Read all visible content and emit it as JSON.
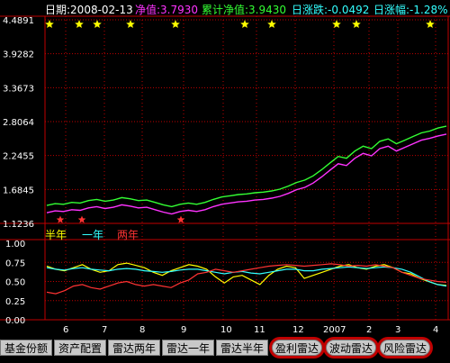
{
  "header": {
    "date_label": "日期:",
    "date_value": "2008-02-13",
    "nav_label": "净值:",
    "nav_value": "3.7930",
    "cum_label": "累计净值:",
    "cum_value": "3.9430",
    "chg_label": "日涨跌:",
    "chg_value": "-0.0492",
    "pct_label": "日涨幅:",
    "pct_value": "-1.28%"
  },
  "colors": {
    "nav_series": "#ff33ff",
    "cum_series": "#33ff33",
    "half_year": "#ffff00",
    "one_year": "#33ffff",
    "two_year": "#ff3333",
    "axis": "#c00000",
    "tick_text": "#ffffff"
  },
  "legend": {
    "half_year": "半年",
    "one_year": "一年",
    "two_year": "两年"
  },
  "tabs": [
    {
      "label": "基金份额",
      "ring": false
    },
    {
      "label": "资产配置",
      "ring": false
    },
    {
      "label": "雷达两年",
      "ring": false
    },
    {
      "label": "雷达一年",
      "ring": false
    },
    {
      "label": "雷达半年",
      "ring": false
    },
    {
      "label": "盈利雷达",
      "ring": true
    },
    {
      "label": "波动雷达",
      "ring": true
    },
    {
      "label": "风险雷达",
      "ring": true
    }
  ],
  "chart_data": [
    {
      "type": "line",
      "ylim": [
        1.1236,
        4.4891
      ],
      "y_ticks": [
        "4.4891",
        "3.9282",
        "3.3673",
        "2.8064",
        "2.2455",
        "1.6845",
        "1.1236"
      ],
      "x_ticks": [
        "6",
        "7",
        "8",
        "9",
        "10",
        "11",
        "12",
        "2007",
        "2",
        "3",
        "4"
      ],
      "series": [
        {
          "key": "cum",
          "values": [
            1.42,
            1.45,
            1.44,
            1.47,
            1.46,
            1.5,
            1.52,
            1.49,
            1.51,
            1.55,
            1.53,
            1.5,
            1.51,
            1.47,
            1.43,
            1.4,
            1.44,
            1.46,
            1.44,
            1.47,
            1.52,
            1.56,
            1.58,
            1.6,
            1.61,
            1.63,
            1.64,
            1.66,
            1.69,
            1.74,
            1.8,
            1.84,
            1.91,
            2.01,
            2.12,
            2.23,
            2.2,
            2.32,
            2.4,
            2.36,
            2.48,
            2.52,
            2.44,
            2.5,
            2.56,
            2.62,
            2.65,
            2.7,
            2.73
          ]
        },
        {
          "key": "nav",
          "values": [
            1.3,
            1.33,
            1.32,
            1.35,
            1.34,
            1.38,
            1.4,
            1.37,
            1.39,
            1.43,
            1.41,
            1.38,
            1.39,
            1.35,
            1.31,
            1.28,
            1.32,
            1.34,
            1.32,
            1.35,
            1.4,
            1.44,
            1.46,
            1.48,
            1.49,
            1.51,
            1.52,
            1.54,
            1.57,
            1.62,
            1.68,
            1.72,
            1.79,
            1.89,
            2.0,
            2.11,
            2.08,
            2.2,
            2.28,
            2.24,
            2.36,
            2.4,
            2.32,
            2.38,
            2.44,
            2.5,
            2.53,
            2.57,
            2.6
          ]
        }
      ],
      "star_markers_top_count": 9,
      "star_markers_bottom_count": 3
    },
    {
      "type": "line",
      "ylim": [
        0.0,
        1.0
      ],
      "y_ticks": [
        "1.00",
        "0.75",
        "0.50",
        "0.25",
        "0.00"
      ],
      "series": [
        {
          "key": "half_year",
          "name": "半年",
          "values": [
            0.7,
            0.66,
            0.64,
            0.68,
            0.72,
            0.66,
            0.62,
            0.64,
            0.72,
            0.74,
            0.71,
            0.68,
            0.62,
            0.58,
            0.64,
            0.68,
            0.72,
            0.7,
            0.66,
            0.56,
            0.48,
            0.56,
            0.58,
            0.52,
            0.46,
            0.58,
            0.66,
            0.7,
            0.68,
            0.54,
            0.58,
            0.62,
            0.66,
            0.7,
            0.72,
            0.68,
            0.66,
            0.7,
            0.72,
            0.68,
            0.62,
            0.6,
            0.54,
            0.5,
            0.46,
            0.45
          ]
        },
        {
          "key": "one_year",
          "name": "一年",
          "values": [
            0.68,
            0.66,
            0.65,
            0.67,
            0.68,
            0.66,
            0.65,
            0.64,
            0.66,
            0.67,
            0.66,
            0.64,
            0.63,
            0.62,
            0.63,
            0.65,
            0.66,
            0.66,
            0.64,
            0.62,
            0.6,
            0.62,
            0.63,
            0.61,
            0.6,
            0.62,
            0.64,
            0.66,
            0.66,
            0.64,
            0.64,
            0.66,
            0.67,
            0.68,
            0.69,
            0.68,
            0.67,
            0.68,
            0.69,
            0.68,
            0.66,
            0.62,
            0.56,
            0.5,
            0.46,
            0.44
          ]
        },
        {
          "key": "two_year",
          "name": "两年",
          "values": [
            0.36,
            0.34,
            0.38,
            0.44,
            0.46,
            0.42,
            0.4,
            0.44,
            0.48,
            0.5,
            0.46,
            0.44,
            0.46,
            0.44,
            0.42,
            0.48,
            0.52,
            0.6,
            0.62,
            0.66,
            0.64,
            0.62,
            0.64,
            0.66,
            0.68,
            0.7,
            0.71,
            0.72,
            0.71,
            0.7,
            0.71,
            0.72,
            0.73,
            0.72,
            0.7,
            0.71,
            0.7,
            0.72,
            0.7,
            0.68,
            0.62,
            0.58,
            0.54,
            0.52,
            0.5,
            0.49
          ]
        }
      ]
    }
  ]
}
